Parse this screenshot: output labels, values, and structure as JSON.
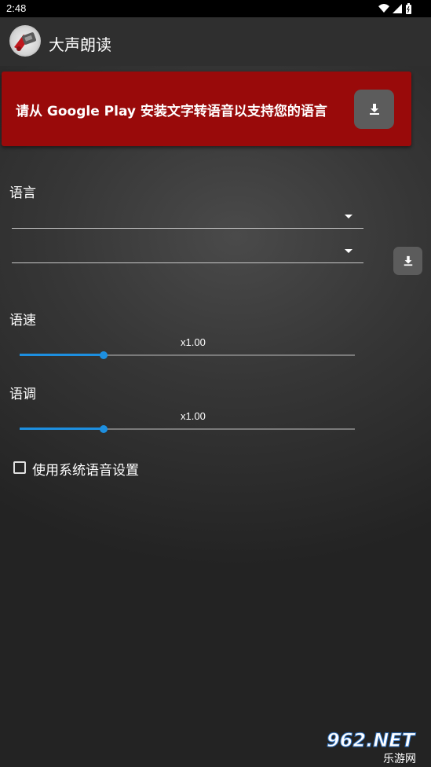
{
  "status_bar": {
    "time": "2:48",
    "icons": [
      "wifi-icon",
      "signal-icon",
      "battery-icon"
    ]
  },
  "app_bar": {
    "title": "大声朗读",
    "icon": "app-logo-icon"
  },
  "banner": {
    "message": "请从 Google Play 安装文字转语音以支持您的语言",
    "button_icon": "download-icon",
    "background": "#990a0a"
  },
  "language": {
    "label": "语言",
    "dropdown_1_value": "",
    "dropdown_2_value": "",
    "download_icon": "download-icon"
  },
  "speed": {
    "label": "语速",
    "value_text": "x1.00",
    "level": 0.25
  },
  "pitch": {
    "label": "语调",
    "value_text": "x1.00",
    "level": 0.25
  },
  "system_settings": {
    "label": "使用系统语音设置",
    "checked": false
  },
  "watermark": {
    "text_top": "962.NET",
    "text_bottom": "乐游网"
  },
  "colors": {
    "accent": "#1d8fe0",
    "app_bar": "#2f2f2f",
    "button": "#5c5c5c"
  }
}
